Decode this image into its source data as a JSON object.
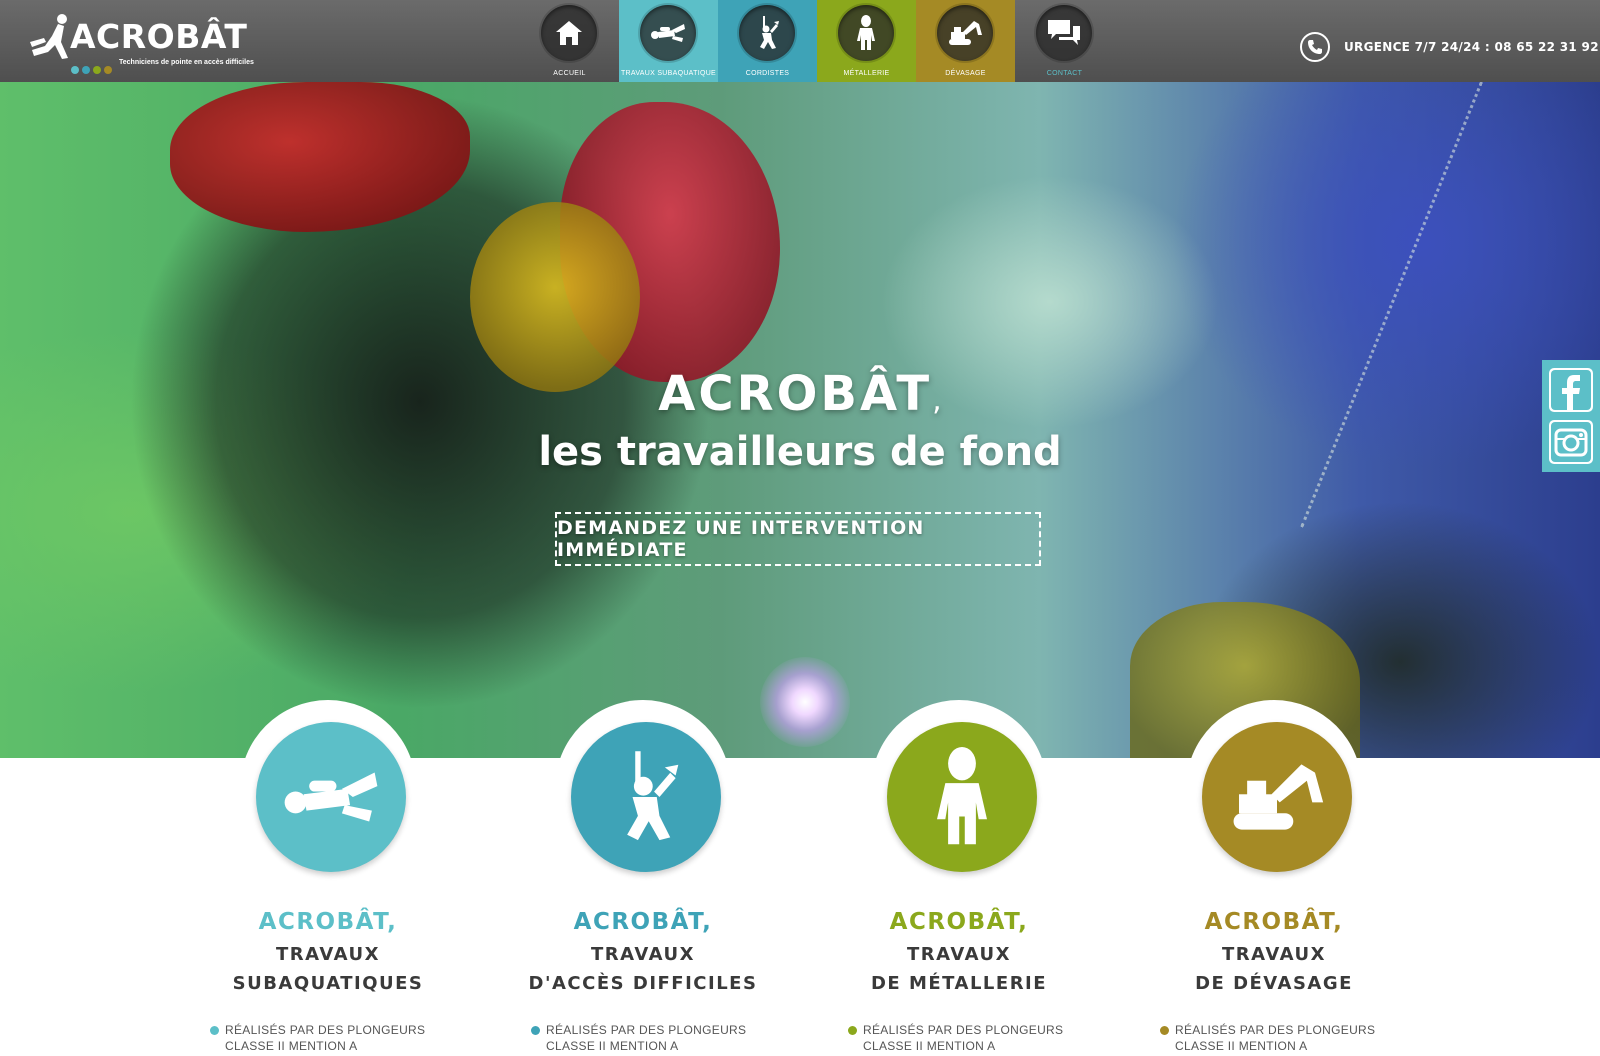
{
  "header": {
    "logo_text": "ACROBÂT",
    "logo_tagline": "Techniciens de pointe en accès difficiles",
    "logo_dot_colors": [
      "#5cbfc8",
      "#3ea3b7",
      "#8ba81c",
      "#a58a25"
    ],
    "nav": [
      {
        "label": "ACCUEIL",
        "icon": "home-icon",
        "bg": "transparent",
        "active": false
      },
      {
        "label": "TRAVAUX SUBAQUATIQUE",
        "icon": "diver-icon",
        "bg": "#5cbfc8",
        "active": false
      },
      {
        "label": "CORDISTES",
        "icon": "climber-icon",
        "bg": "#3ea3b7",
        "active": false
      },
      {
        "label": "MÉTALLERIE",
        "icon": "suit-icon",
        "bg": "#8ba81c",
        "active": false
      },
      {
        "label": "DÉVASAGE",
        "icon": "excavator-icon",
        "bg": "#a58a25",
        "active": false
      },
      {
        "label": "CONTACT",
        "icon": "chat-icon",
        "bg": "transparent",
        "active": true
      }
    ],
    "phone_text": "URGENCE 7/7 24/24 : 08 65 22 31 92"
  },
  "hero": {
    "title_line1": "ACROBÂT",
    "title_comma": ",",
    "title_line2": "les travailleurs de fond",
    "cta_label": "DEMANDEZ UNE INTERVENTION IMMÉDIATE"
  },
  "social": {
    "items": [
      {
        "icon": "facebook-icon"
      },
      {
        "icon": "instagram-icon"
      }
    ],
    "bg": "#5cbfc8"
  },
  "services": [
    {
      "title": "ACROBÂT,",
      "subtitle": "TRAVAUX\nSUBAQUATIQUES",
      "bullet": "RÉALISÉS PAR DES PLONGEURS\nCLASSE II MENTION A",
      "color": "#5cbfc8",
      "icon": "diver-icon"
    },
    {
      "title": "ACROBÂT,",
      "subtitle": "TRAVAUX\nD'ACCÈS DIFFICILES",
      "bullet": "RÉALISÉS PAR DES PLONGEURS\nCLASSE II MENTION A",
      "color": "#3ea3b7",
      "icon": "climber-icon"
    },
    {
      "title": "ACROBÂT,",
      "subtitle": "TRAVAUX\nDE MÉTALLERIE",
      "bullet": "RÉALISÉS PAR DES PLONGEURS\nCLASSE II MENTION A",
      "color": "#8ba81c",
      "icon": "suit-icon"
    },
    {
      "title": "ACROBÂT,",
      "subtitle": "TRAVAUX\nDE DÉVASAGE",
      "bullet": "RÉALISÉS PAR DES PLONGEURS\nCLASSE II MENTION A",
      "color": "#a58a25",
      "icon": "excavator-icon"
    }
  ]
}
